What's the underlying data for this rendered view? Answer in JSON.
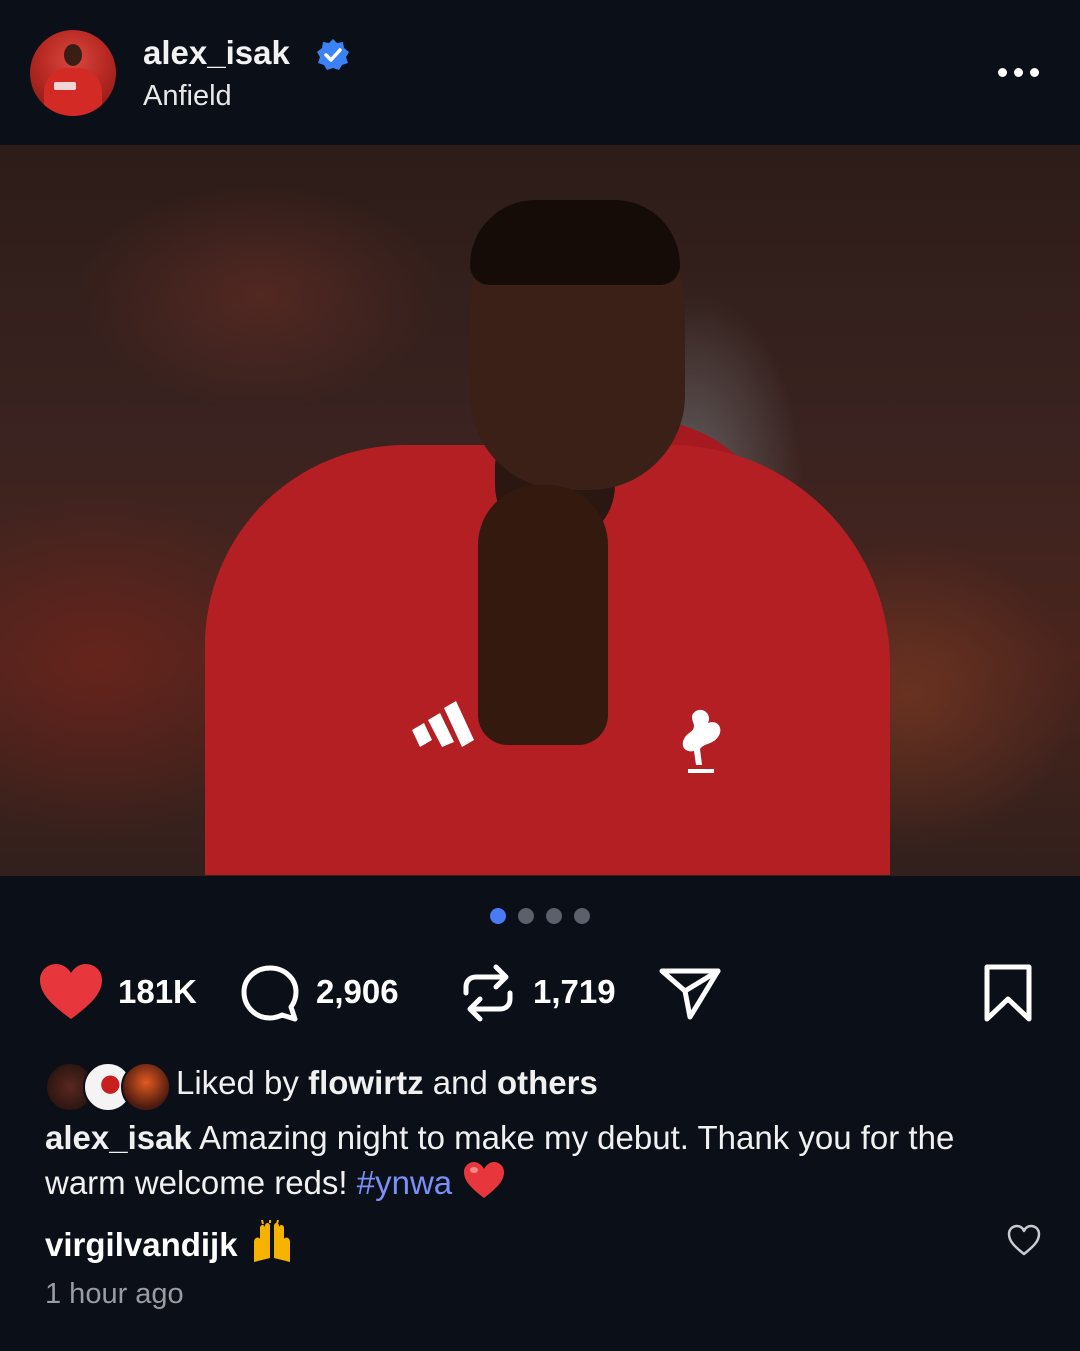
{
  "post": {
    "username": "alex_isak",
    "location": "Anfield",
    "verified": true
  },
  "carousel": {
    "total": 4,
    "active_index": 0
  },
  "actions": {
    "likes": "181K",
    "comments": "2,906",
    "reposts": "1,719"
  },
  "liked_by": {
    "prefix": "Liked by ",
    "user": "flowirtz",
    "middle": " and ",
    "others": "others"
  },
  "caption": {
    "user": "alex_isak",
    "text": " Amazing night to make my debut. Thank you for the warm welcome reds! ",
    "hashtag": "#ynwa"
  },
  "comment": {
    "user": "virgilvandijk"
  },
  "timestamp": "1 hour ago",
  "colors": {
    "background": "#0b0f17",
    "like_red": "#e8363d",
    "hashtag": "#7b8ff7",
    "verified_blue": "#3b82f6",
    "dot_active": "#4a7bf5"
  },
  "icons": {
    "more": "more-horizontal-icon",
    "like": "heart-filled-icon",
    "comment": "comment-bubble-icon",
    "repost": "repost-icon",
    "share": "send-icon",
    "save": "bookmark-icon",
    "comment_like": "heart-outline-icon"
  }
}
